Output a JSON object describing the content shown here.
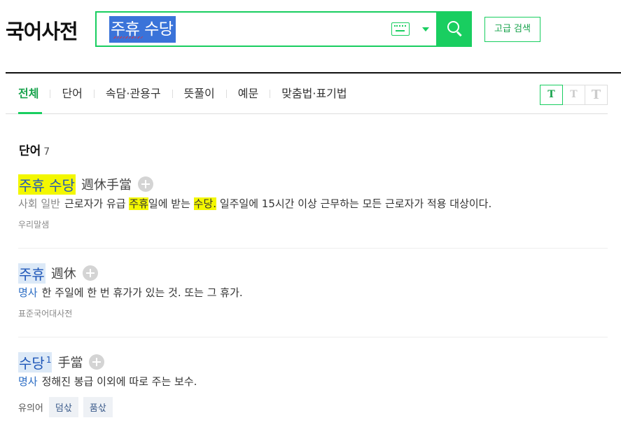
{
  "app": {
    "logo": "국어사전"
  },
  "search": {
    "query": "주휴 수당",
    "button_label": "검색",
    "advanced_label": "고급 검색"
  },
  "tabs": [
    {
      "label": "전체",
      "active": true
    },
    {
      "label": "단어",
      "active": false
    },
    {
      "label": "속담·관용구",
      "active": false
    },
    {
      "label": "뜻풀이",
      "active": false
    },
    {
      "label": "예문",
      "active": false
    },
    {
      "label": "맞춤법·표기법",
      "active": false
    }
  ],
  "font_size": [
    "T",
    "T",
    "T"
  ],
  "section": {
    "title": "단어",
    "count": "7"
  },
  "entries": [
    {
      "headword": "주휴 수당",
      "hanja": "週休手當",
      "pos": "사회 일반",
      "def_parts": [
        "근로자가 유급 ",
        "주휴",
        "일에 받는 ",
        "수당.",
        " 일주일에 15시간 이상 근무하는 모든 근로자가 적용 대상이다."
      ],
      "source": "우리말샘"
    },
    {
      "headword": "주휴",
      "hanja": "週休",
      "pos": "명사",
      "definition": "한 주일에 한 번 휴가가 있는 것. 또는 그 휴가.",
      "source": "표준국어대사전"
    },
    {
      "headword": "수당",
      "sup": "1",
      "hanja": "手當",
      "pos": "명사",
      "definition": "정해진 봉급 이외에 따로 주는 보수.",
      "synonym_label": "유의어",
      "synonyms": [
        "덤삯",
        "품삯"
      ]
    }
  ],
  "colors": {
    "accent": "#19ce60",
    "highlight": "#f3f700",
    "link": "#1f57b8"
  }
}
